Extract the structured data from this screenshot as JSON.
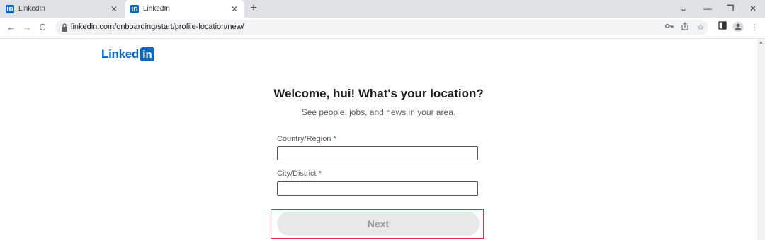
{
  "browser": {
    "tabs": [
      {
        "title": "LinkedIn",
        "favicon": "in",
        "active": false
      },
      {
        "title": "LinkedIn",
        "favicon": "in",
        "active": true
      }
    ],
    "new_tab_symbol": "+",
    "close_symbol": "✕",
    "window_controls": {
      "dropdown": "⌄",
      "minimize": "—",
      "restore": "❐",
      "close": "✕"
    },
    "nav": {
      "back": "←",
      "forward": "→",
      "reload": "C"
    },
    "url": "linkedin.com/onboarding/start/profile-location/new/",
    "omnibox_icons": [
      "key-icon",
      "share-icon",
      "star-icon"
    ],
    "toolbar_icons": [
      "side-panel-icon",
      "profile-icon",
      "menu-icon"
    ]
  },
  "page": {
    "logo": {
      "word": "Linked",
      "box": "in"
    },
    "heading": "Welcome, hui! What's your location?",
    "subheading": "See people, jobs, and news in your area.",
    "fields": [
      {
        "label": "Country/Region",
        "required_mark": "*",
        "value": ""
      },
      {
        "label": "City/District",
        "required_mark": "*",
        "value": ""
      }
    ],
    "next_button": "Next"
  },
  "colors": {
    "brand": "#0a66c2",
    "highlight": "#e0302e",
    "disabled_button": "#e8e8e8"
  }
}
